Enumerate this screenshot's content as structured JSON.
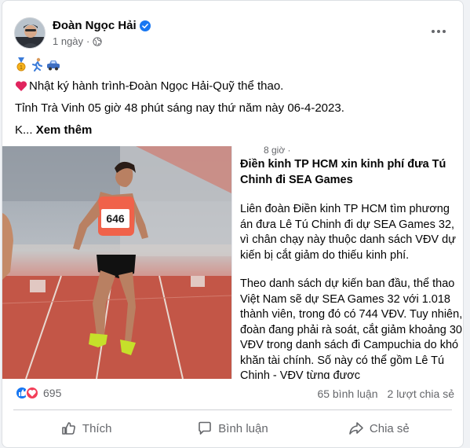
{
  "post": {
    "author_name": "Đoàn Ngọc Hải",
    "timestamp": "1 ngày",
    "timestamp_separator": "·",
    "emoji_line": [
      "medal",
      "runner",
      "car"
    ],
    "line1_text": "Nhật ký hành trình-Đoàn Ngọc Hải-Quỹ thể thao.",
    "line2_text": "Tỉnh Trà Vinh 05 giờ 48 phút sáng nay thứ năm này 06-4-2023.",
    "line3_prefix": "K...",
    "see_more": "Xem thêm"
  },
  "shared_image": {
    "bib_number": "646",
    "inner_time": "8 giờ ·",
    "headline": "Điền kinh TP HCM xin kinh phí đưa Tú Chinh đi SEA Games",
    "paragraph1": "Liên đoàn Điền kinh TP HCM tìm phương án đưa Lê Tú Chinh đi dự SEA Games 32, vì chân chạy này thuộc danh sách VĐV dự kiến bị cắt giảm do thiếu kinh phí.",
    "paragraph2": "Theo danh sách dự kiến ban đầu, thể thao Việt Nam sẽ dự SEA Games 32 với 1.018 thành viên, trong đó có 744 VĐV. Tuy nhiên, đoàn đang phải rà soát, cắt giảm khoảng 30 VĐV trong danh sách đi Campuchia do khó khăn tài chính. Số này có thể gồm Lê Tú Chinh - VĐV từng được"
  },
  "stats": {
    "reaction_count": "695",
    "comments": "65 bình luận",
    "shares": "2 lượt chia sẻ"
  },
  "actions": {
    "like": "Thích",
    "comment": "Bình luận",
    "share": "Chia sẻ"
  },
  "colors": {
    "like_blue": "#1877f2",
    "love_red": "#f33e58",
    "track_red": "#c8594a",
    "text_secondary": "#65676b"
  }
}
